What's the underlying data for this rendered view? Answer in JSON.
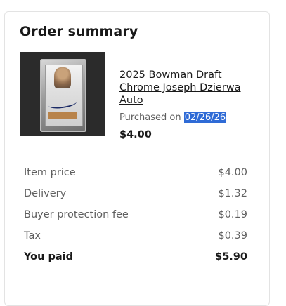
{
  "order_summary": {
    "title": "Order summary",
    "item": {
      "title": "2025 Bowman Draft Chrome Joseph Dzierwa Auto",
      "purchased_prefix": "Purchased on ",
      "purchased_date": "02/26/26",
      "price": "$4.00"
    },
    "lines": [
      {
        "label": "Item price",
        "value": "$4.00"
      },
      {
        "label": "Delivery",
        "value": "$1.32"
      },
      {
        "label": "Buyer protection fee",
        "value": "$0.19"
      },
      {
        "label": "Tax",
        "value": "$0.39"
      }
    ],
    "total": {
      "label": "You paid",
      "value": "$5.90"
    }
  },
  "colors": {
    "text_primary": "#191919",
    "text_secondary": "#5f5f5f",
    "selection_highlight": "#2f6bd6"
  }
}
